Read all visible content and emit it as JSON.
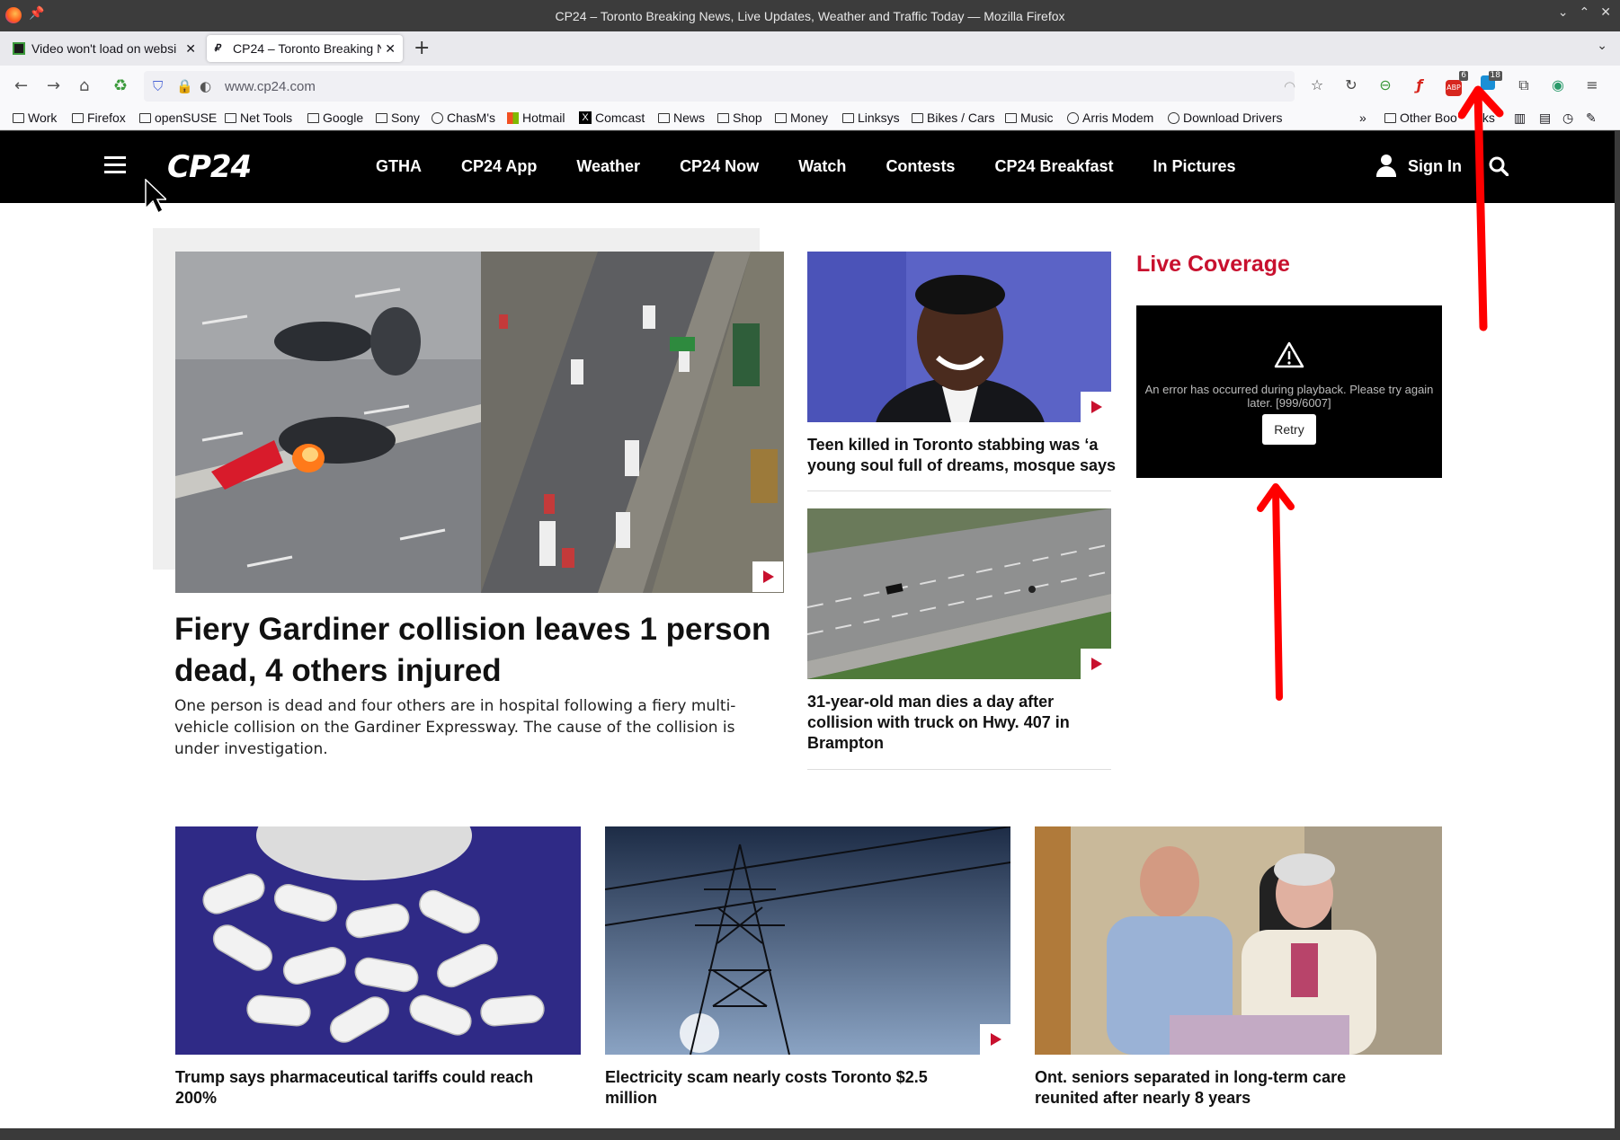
{
  "window": {
    "title": "CP24 – Toronto Breaking News, Live Updates, Weather and Traffic Today — Mozilla Firefox",
    "controls": [
      "chevron-down",
      "chevron-up",
      "close"
    ]
  },
  "tabs": [
    {
      "label": "Video won't load on websi",
      "active": false
    },
    {
      "label": "CP24 – Toronto Breaking N",
      "active": true
    }
  ],
  "urlbar": {
    "url": "www.cp24.com"
  },
  "toolbar_badges": {
    "abp": "6",
    "ext2": "18"
  },
  "bookmarks": [
    {
      "label": "Work",
      "icon": "folder"
    },
    {
      "label": "Firefox",
      "icon": "folder"
    },
    {
      "label": "openSUSE",
      "icon": "folder"
    },
    {
      "label": "Net Tools",
      "icon": "folder"
    },
    {
      "label": "Google",
      "icon": "folder"
    },
    {
      "label": "Sony",
      "icon": "folder"
    },
    {
      "label": "ChasM's",
      "icon": "globe"
    },
    {
      "label": "Hotmail",
      "icon": "windows"
    },
    {
      "label": "Comcast",
      "icon": "x"
    },
    {
      "label": "News",
      "icon": "folder"
    },
    {
      "label": "Shop",
      "icon": "folder"
    },
    {
      "label": "Money",
      "icon": "folder"
    },
    {
      "label": "Linksys",
      "icon": "folder"
    },
    {
      "label": "Bikes / Cars",
      "icon": "folder"
    },
    {
      "label": "Music",
      "icon": "folder"
    },
    {
      "label": "Arris Modem",
      "icon": "globe"
    },
    {
      "label": "Download Drivers",
      "icon": "globe"
    }
  ],
  "bookmarks_other": "Other Boo",
  "bookmarks_other_tail": "ks",
  "site": {
    "logo": "CP24",
    "nav": [
      "GTHA",
      "CP24 App",
      "Weather",
      "CP24 Now",
      "Watch",
      "Contests",
      "CP24 Breakfast",
      "In Pictures"
    ],
    "signin": "Sign In"
  },
  "lead": {
    "title": "Fiery Gardiner collision leaves 1 person dead, 4 others injured",
    "summary": "One person is dead and four others are in hospital following a fiery multi-vehicle collision on the Gardiner Expressway. The cause of the collision is under investigation."
  },
  "side_stories": [
    {
      "title": "Teen killed in Toronto stabbing was ‘a young soul full of dreams, mosque says"
    },
    {
      "title": "31-year-old man dies a day after collision with truck on Hwy. 407 in Brampton"
    }
  ],
  "live": {
    "heading": "Live Coverage",
    "error": "An error has occurred during playback. Please try again later. [999/6007]",
    "retry": "Retry"
  },
  "cards": [
    {
      "title": "Trump says pharmaceutical tariffs could reach 200%"
    },
    {
      "title": "Electricity scam nearly costs Toronto $2.5 million"
    },
    {
      "title": "Ont. seniors separated in long-term care reunited after nearly 8 years"
    }
  ],
  "colors": {
    "brand_red": "#c8102e",
    "nav_bg": "#000000",
    "annotation_arrow": "#ff0000"
  }
}
